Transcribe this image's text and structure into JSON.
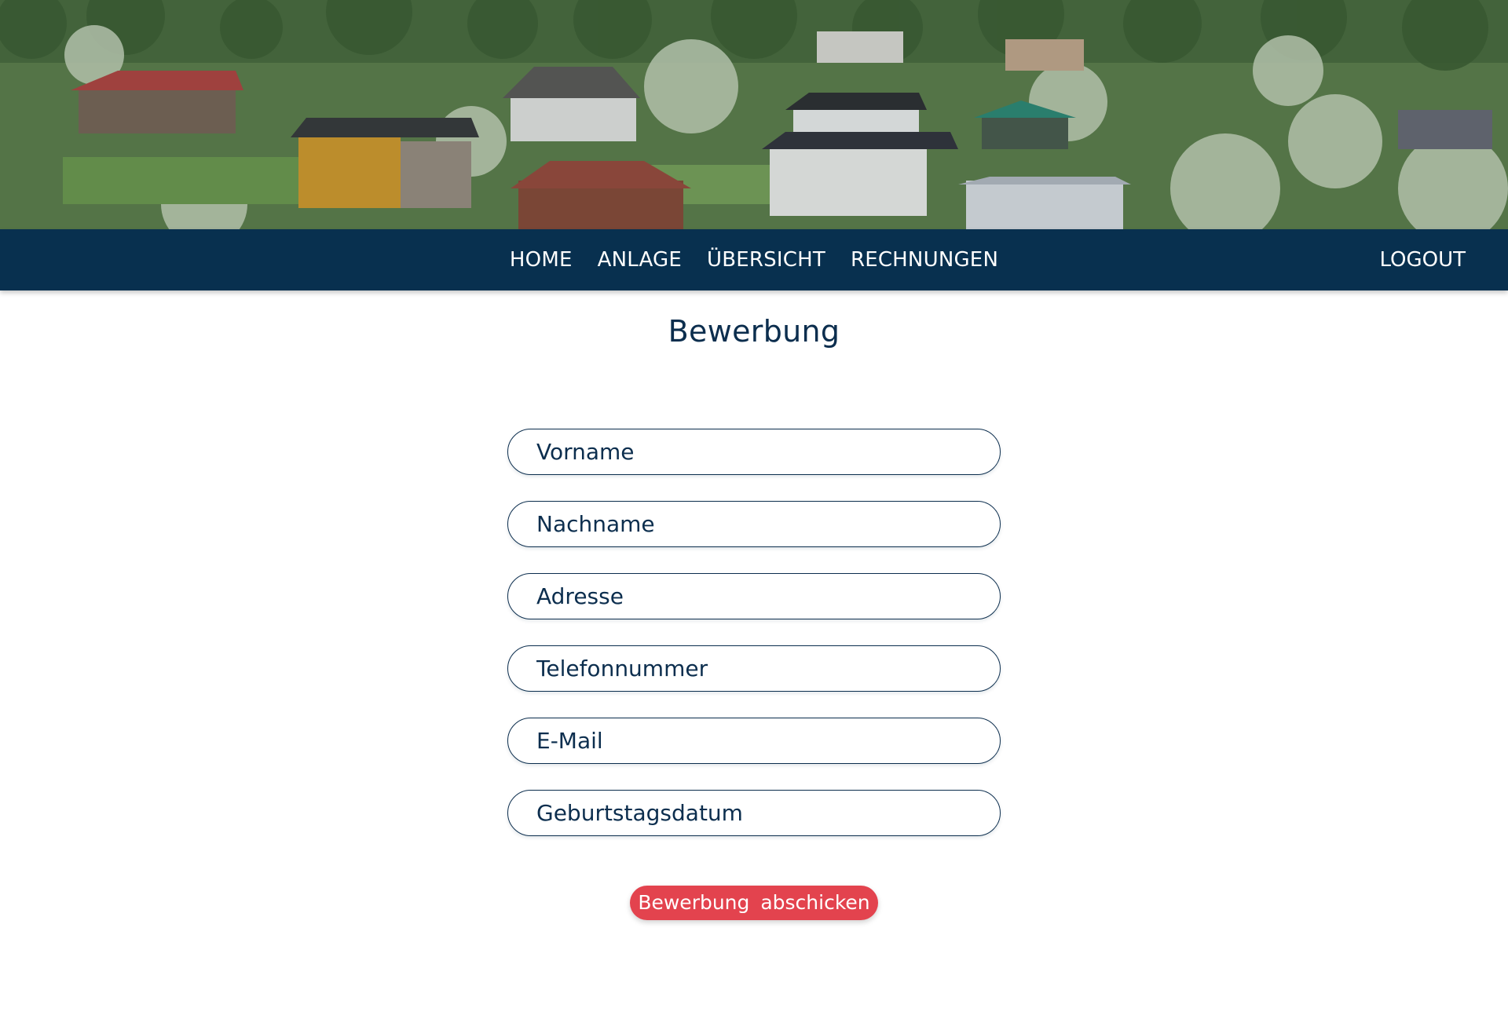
{
  "hero": {
    "image": "allotment-garden-houses-photo"
  },
  "nav": {
    "items": [
      {
        "label": "HOME"
      },
      {
        "label": "ANLAGE"
      },
      {
        "label": "ÜBERSICHT"
      },
      {
        "label": "RECHNUNGEN"
      }
    ],
    "logout_label": "LOGOUT"
  },
  "main": {
    "title": "Bewerbung",
    "fields": [
      {
        "placeholder": "Vorname",
        "value": ""
      },
      {
        "placeholder": "Nachname",
        "value": ""
      },
      {
        "placeholder": "Adresse",
        "value": ""
      },
      {
        "placeholder": "Telefonnummer",
        "value": ""
      },
      {
        "placeholder": "E-Mail",
        "value": ""
      },
      {
        "placeholder": "Geburtstagsdatum",
        "value": ""
      }
    ],
    "submit_label": "Bewerbung abschicken"
  },
  "colors": {
    "navbar_bg": "#08304f",
    "primary_text": "#0c2e4e",
    "accent_button": "#e3434e",
    "background": "#ffffff"
  }
}
